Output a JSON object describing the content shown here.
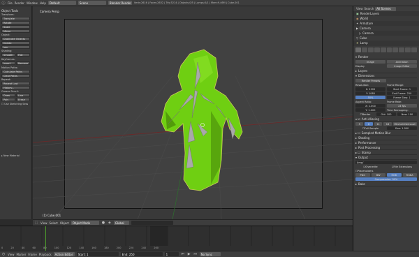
{
  "topbar": {
    "menus": [
      "File",
      "Render",
      "Window",
      "Help"
    ],
    "layout": "Default",
    "scene": "Scene",
    "engine": "Blender Render",
    "stats": "Verts:2616 | Faces:2632 | Tris:5214 | Objects:0/5 | Lamps:0/1 | Mem:9.46M | Cube.001"
  },
  "shelf": {
    "object_tools": "Object Tools",
    "transform_label": "Transform:",
    "transform_buttons": [
      "Translate",
      "Rotate",
      "Scale"
    ],
    "mirror": "Mirror",
    "object_label": "Object:",
    "object_buttons": [
      "Duplicate Objects",
      "Delete",
      "Join"
    ],
    "shading_label": "Shading:",
    "shading_buttons": [
      "Smooth",
      "Flat"
    ],
    "keyframes_label": "Keyframes:",
    "keyframe_buttons": [
      "Insert",
      "Remove"
    ],
    "motion_paths_label": "Motion Paths:",
    "motion_buttons": [
      "Calculate Paths",
      "Clear Paths"
    ],
    "repeat_label": "Repeat:",
    "repeat_buttons": [
      "Repeat Last",
      "History..."
    ],
    "grease_label": "Grease Pencil:",
    "grease_buttons": [
      "Draw",
      "Line",
      "Poly",
      "Erase"
    ],
    "surface_draw": "Use Sketching Sess",
    "new_material": "New Material"
  },
  "viewport": {
    "label": "Camera Persp",
    "object_label": "(1) Cube.001"
  },
  "vhead": {
    "items": [
      "View",
      "Select",
      "Object"
    ],
    "mode": "Object Mode",
    "pivot": "Global"
  },
  "timeline": {
    "ticks": [
      "0",
      "20",
      "40",
      "60",
      "80",
      "100",
      "120",
      "140",
      "160",
      "180",
      "200",
      "220",
      "240",
      "260"
    ],
    "menus": [
      "View",
      "Marker",
      "Frame",
      "Playback"
    ],
    "start": "Start: 1",
    "end": "End: 250",
    "current": "1",
    "keying": "Action Editor",
    "range": "No Sync"
  },
  "outliner": {
    "header": [
      "View",
      "Search",
      "All Scenes"
    ],
    "rows": [
      "RenderLayers",
      "World",
      "Armature",
      "Camera",
      "Camera",
      "Cube",
      "Lamp"
    ]
  },
  "props": {
    "panels": {
      "render_title": "Render",
      "render_buttons": [
        "Image",
        "Animation"
      ],
      "display": "Display",
      "display_value": "Image Editor",
      "layers": "Layers",
      "dimensions": "Dimensions",
      "preset": "Render Presets",
      "resolution_label": "Resolution:",
      "res_x": "X: 1920",
      "res_y": "Y: 1080",
      "res_pct": "50%",
      "frame_label": "Frame Range:",
      "start_frame": "Start Frame: 1",
      "end_frame": "End Frame: 250",
      "frame_step": "Frame Step: 1",
      "aspect_label": "Aspect Ratio:",
      "asp_x": "X: 1.000",
      "asp_y": "Y: 1.000",
      "fps_label": "Frame Rate:",
      "fps": "24 fps",
      "border": "Border",
      "crop": "Crop",
      "time_remap": "Time Remapping:",
      "old": "Old: 100",
      "new": "New: 100",
      "aa": "Anti-Aliasing",
      "aa_values": [
        "5",
        "8",
        "11",
        "16"
      ],
      "filter": "Mitchell-Netravali",
      "full_sample": "Full Sample",
      "size": "Size: 1.000",
      "sampled_motion": "Sampled Motion Blur",
      "shading": "Shading",
      "performance": "Performance",
      "post_processing": "Post Processing",
      "stamp": "Stamp",
      "output": "Output",
      "output_path": "/tmp/",
      "overwrite": "Overwrite",
      "file_ext": "File Extensions",
      "placeholders": "Placeholders",
      "format": "PNG",
      "color_modes": [
        "BW",
        "RGB",
        "RGBA"
      ],
      "compression": "Compression: 90%",
      "bake": "Bake"
    }
  },
  "colors": {
    "mesh": "#6fcf12",
    "mesh_dark": "#2e5a05",
    "bone": "#a9a9a9",
    "accent": "#5680c2"
  }
}
